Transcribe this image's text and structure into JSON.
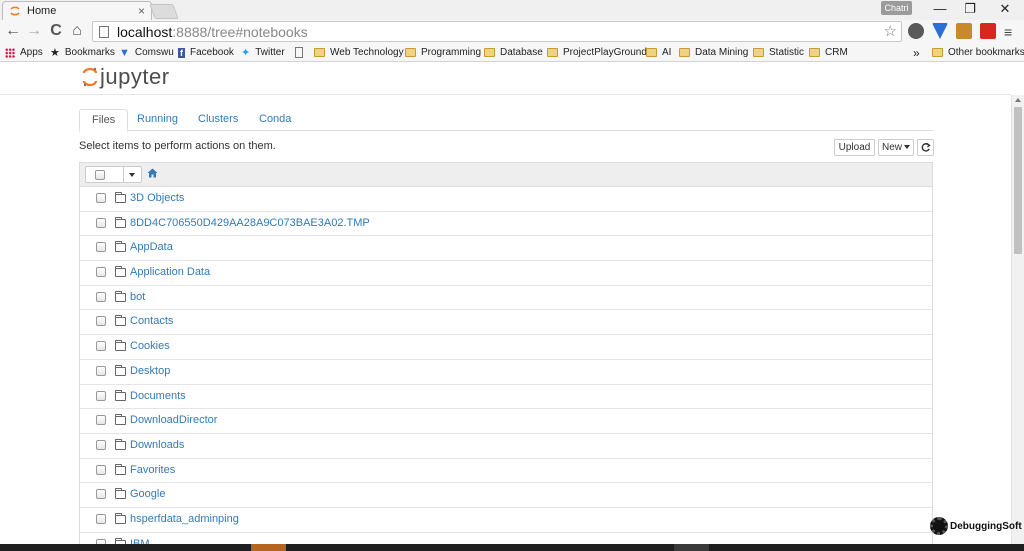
{
  "browser": {
    "tab_title": "Home",
    "tab_close": "×",
    "user_badge": "Chatri",
    "window_controls": {
      "minimize": "—",
      "restore": "❐",
      "close": "✕"
    },
    "nav": {
      "back": "←",
      "forward": "→",
      "reload": "C",
      "home": "⌂"
    },
    "url_host": "localhost",
    "url_path": ":8888/tree#notebooks",
    "star": "☆",
    "extension_icons": [
      "puzzle-icon",
      "shield-v-icon",
      "download-box-icon",
      "red-bookmark-icon"
    ],
    "menu": "≡"
  },
  "bookmarks": [
    {
      "label": "Apps",
      "icon": "apps-icon"
    },
    {
      "label": "Bookmarks",
      "icon": "star-icon"
    },
    {
      "label": "Comswu",
      "icon": "comswu-icon"
    },
    {
      "label": "Facebook",
      "icon": "facebook-icon"
    },
    {
      "label": "Twitter",
      "icon": "twitter-icon"
    },
    {
      "label": "",
      "icon": "page-icon"
    },
    {
      "label": "Web Technology",
      "icon": "folder-icon"
    },
    {
      "label": "Programming",
      "icon": "folder-icon"
    },
    {
      "label": "Database",
      "icon": "folder-icon"
    },
    {
      "label": "ProjectPlayGroundD",
      "icon": "folder-icon"
    },
    {
      "label": "AI",
      "icon": "folder-icon"
    },
    {
      "label": "Data Mining",
      "icon": "folder-icon"
    },
    {
      "label": "Statistic",
      "icon": "folder-icon"
    },
    {
      "label": "CRM",
      "icon": "folder-icon"
    }
  ],
  "bookmarks_overflow": "»",
  "other_bookmarks": "Other bookmarks",
  "jupyter": {
    "logo_text": "jupyter",
    "tabs": [
      "Files",
      "Running",
      "Clusters",
      "Conda"
    ],
    "active_tab": "Files",
    "hint": "Select items to perform actions on them.",
    "upload_label": "Upload",
    "new_label": "New",
    "files": [
      "3D Objects",
      "8DD4C706550D429AA28A9C073BAE3A02.TMP",
      "AppData",
      "Application Data",
      "bot",
      "Contacts",
      "Cookies",
      "Desktop",
      "Documents",
      "DownloadDirector",
      "Downloads",
      "Favorites",
      "Google",
      "hsperfdata_adminping",
      "IBM"
    ]
  },
  "watermark": "DebuggingSoft",
  "colors": {
    "link": "#337ab7",
    "jupyter_orange": "#f37726",
    "chrome_bg": "#f6f6f6"
  }
}
